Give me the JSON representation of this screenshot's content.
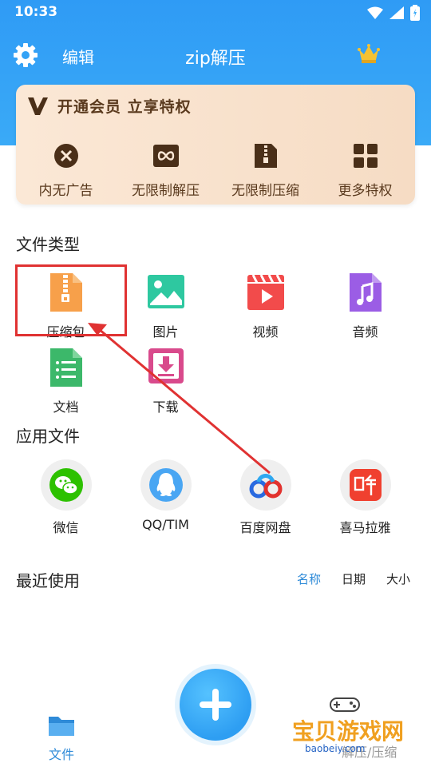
{
  "status": {
    "time": "10:33"
  },
  "appbar": {
    "edit": "编辑",
    "title": "zip解压"
  },
  "vip": {
    "title": "开通会员 立享特权",
    "perks": [
      {
        "label": "内无广告",
        "icon": "close-circle-icon"
      },
      {
        "label": "无限制解压",
        "icon": "infinity-icon"
      },
      {
        "label": "无限制压缩",
        "icon": "zip-icon"
      },
      {
        "label": "更多特权",
        "icon": "grid-icon"
      }
    ]
  },
  "file_types": {
    "title": "文件类型",
    "items": [
      {
        "label": "压缩包",
        "icon": "archive-icon",
        "color": "#f7a04a"
      },
      {
        "label": "图片",
        "icon": "image-icon",
        "color": "#2ec8a0"
      },
      {
        "label": "视频",
        "icon": "video-icon",
        "color": "#f24b4b"
      },
      {
        "label": "音频",
        "icon": "audio-icon",
        "color": "#9b5de5"
      },
      {
        "label": "文档",
        "icon": "document-icon",
        "color": "#3cb86a"
      },
      {
        "label": "下载",
        "icon": "download-icon",
        "color": "#d94a8c"
      }
    ]
  },
  "app_files": {
    "title": "应用文件",
    "items": [
      {
        "label": "微信",
        "icon": "wechat-icon"
      },
      {
        "label": "QQ/TIM",
        "icon": "qq-icon"
      },
      {
        "label": "百度网盘",
        "icon": "baidu-netdisk-icon"
      },
      {
        "label": "喜马拉雅",
        "icon": "ximalaya-icon"
      }
    ]
  },
  "recent": {
    "title": "最近使用",
    "sort": [
      "名称",
      "日期",
      "大小"
    ]
  },
  "tabs": {
    "files": "文件",
    "extract": "解压/压缩"
  },
  "watermark": {
    "text": "宝贝游戏网",
    "url": "baobeiy.com"
  }
}
